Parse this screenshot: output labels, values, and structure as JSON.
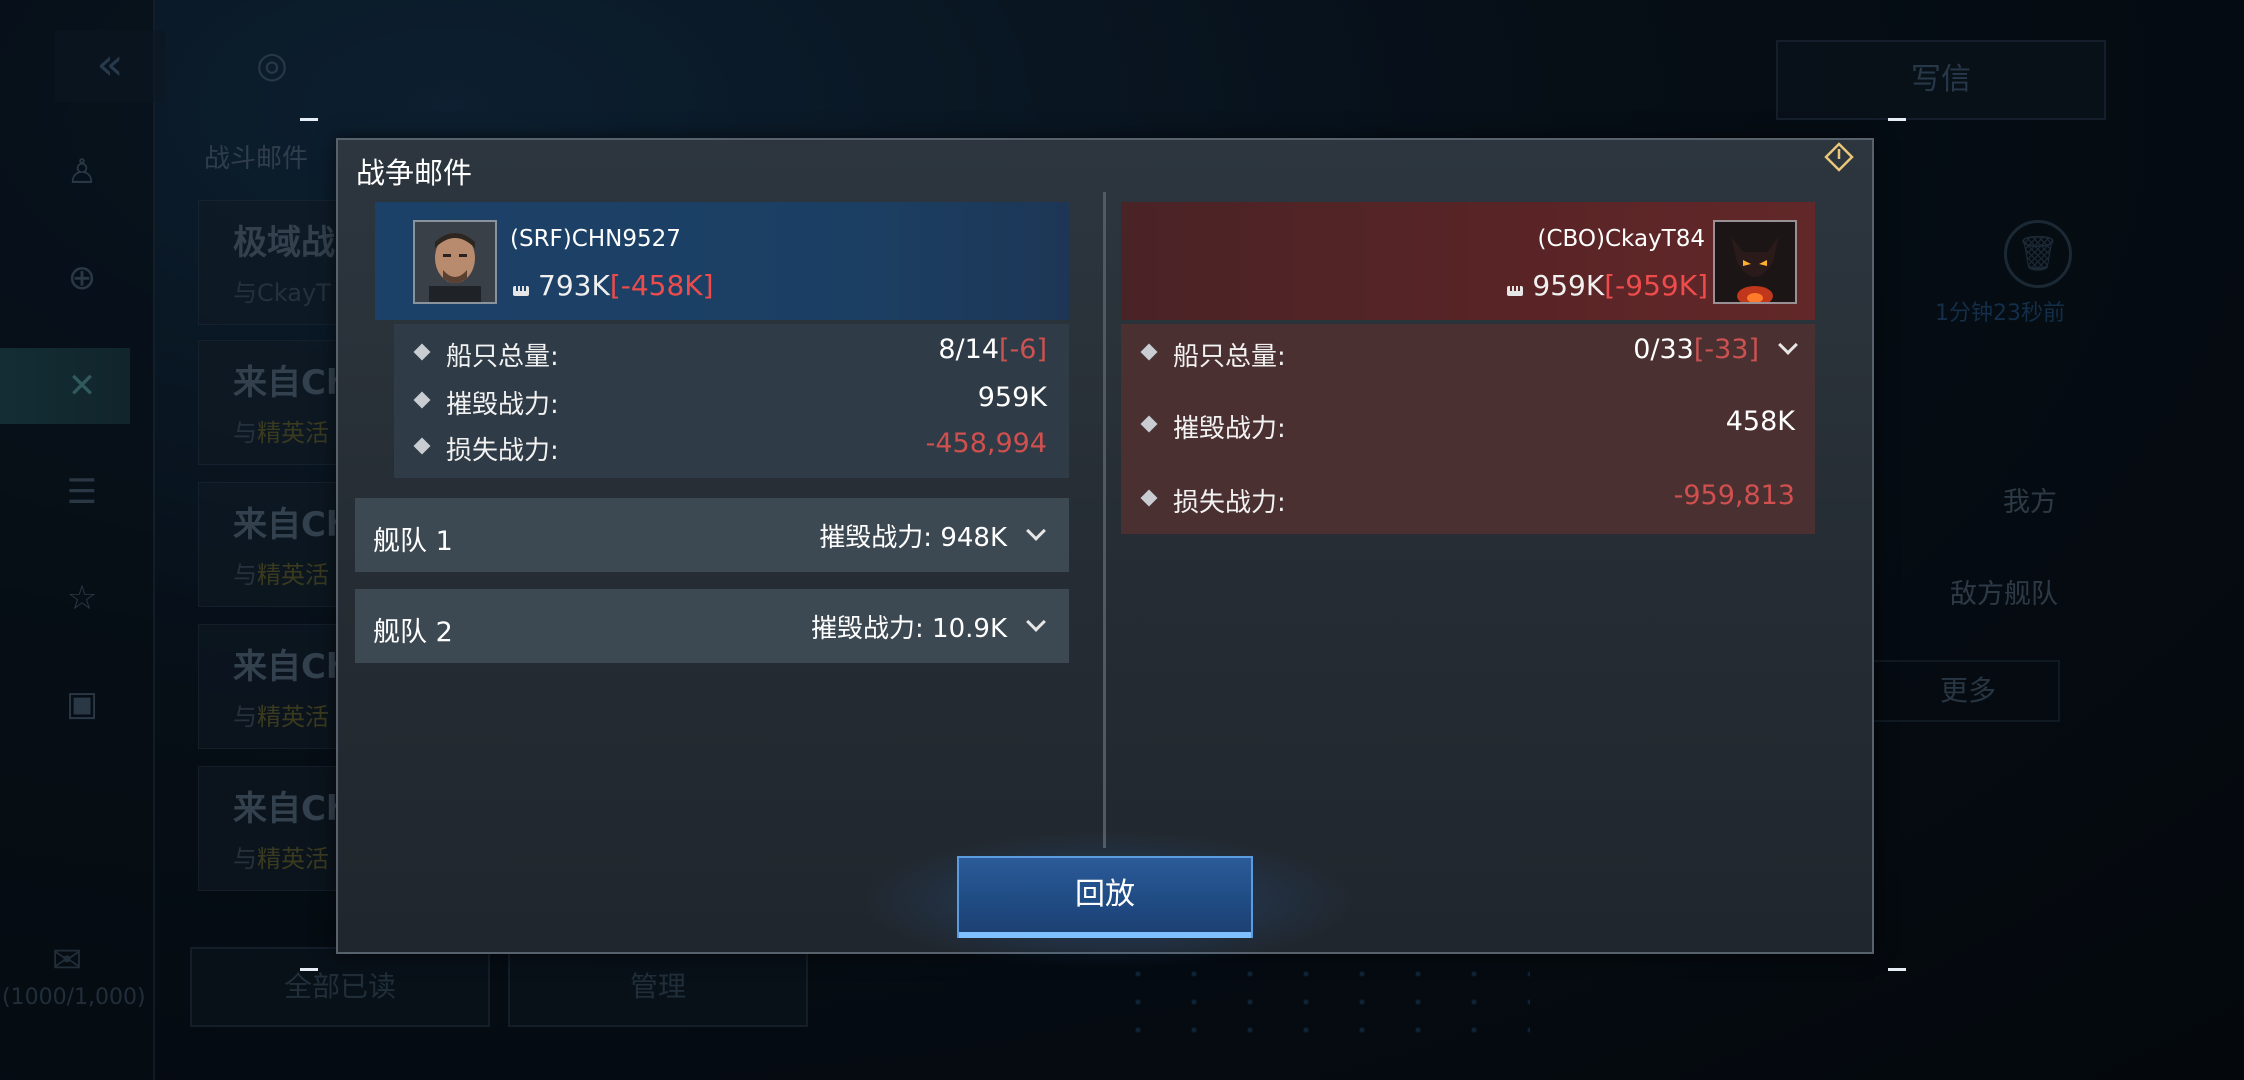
{
  "background": {
    "section_title": "战斗邮件",
    "write_button": "写信",
    "time_ago": "1分钟23秒前",
    "label_our_side": "我方",
    "label_enemy_fleet": "敌方舰队",
    "more_button": "更多",
    "mark_all_read": "全部已读",
    "manage": "管理",
    "mail_count": "(1000/1,000)",
    "mail_items": [
      {
        "title": "极域战",
        "subtitle": "与CkayT"
      },
      {
        "title": "来自Ch",
        "subtitle_prefix": "与",
        "subtitle_hl": "精英活"
      },
      {
        "title": "来自Ch",
        "subtitle_prefix": "与",
        "subtitle_hl": "精英活"
      },
      {
        "title": "来自Ch",
        "subtitle_prefix": "与",
        "subtitle_hl": "精英活"
      },
      {
        "title": "来自Ch",
        "subtitle_prefix": "与",
        "subtitle_hl": "精英活"
      }
    ]
  },
  "dialog": {
    "title": "战争邮件",
    "replay_button": "回放"
  },
  "left_player": {
    "name": "(SRF)CHN9527",
    "power": "793K",
    "power_delta": "[-458K]",
    "stats": [
      {
        "label": "船只总量:",
        "value": "8/14",
        "delta": "[-6]"
      },
      {
        "label": "摧毁战力:",
        "value": "959K"
      },
      {
        "label": "损失战力:",
        "value": "-458,994"
      }
    ],
    "fleets": [
      {
        "name": "舰队 1",
        "damage": "摧毁战力: 948K"
      },
      {
        "name": "舰队 2",
        "damage": "摧毁战力: 10.9K"
      }
    ]
  },
  "right_player": {
    "name": "(CBO)CkayT84",
    "power": "959K",
    "power_delta": "[-959K]",
    "stats": [
      {
        "label": "船只总量:",
        "value": "0/33",
        "delta": "[-33]"
      },
      {
        "label": "摧毁战力:",
        "value": "458K"
      },
      {
        "label": "损失战力:",
        "value": "-959,813"
      }
    ]
  },
  "colors": {
    "left_header": "#1c4168",
    "right_header": "#5a2426",
    "negative": "#ee4c4c",
    "replay_button": "#1f4a82"
  }
}
